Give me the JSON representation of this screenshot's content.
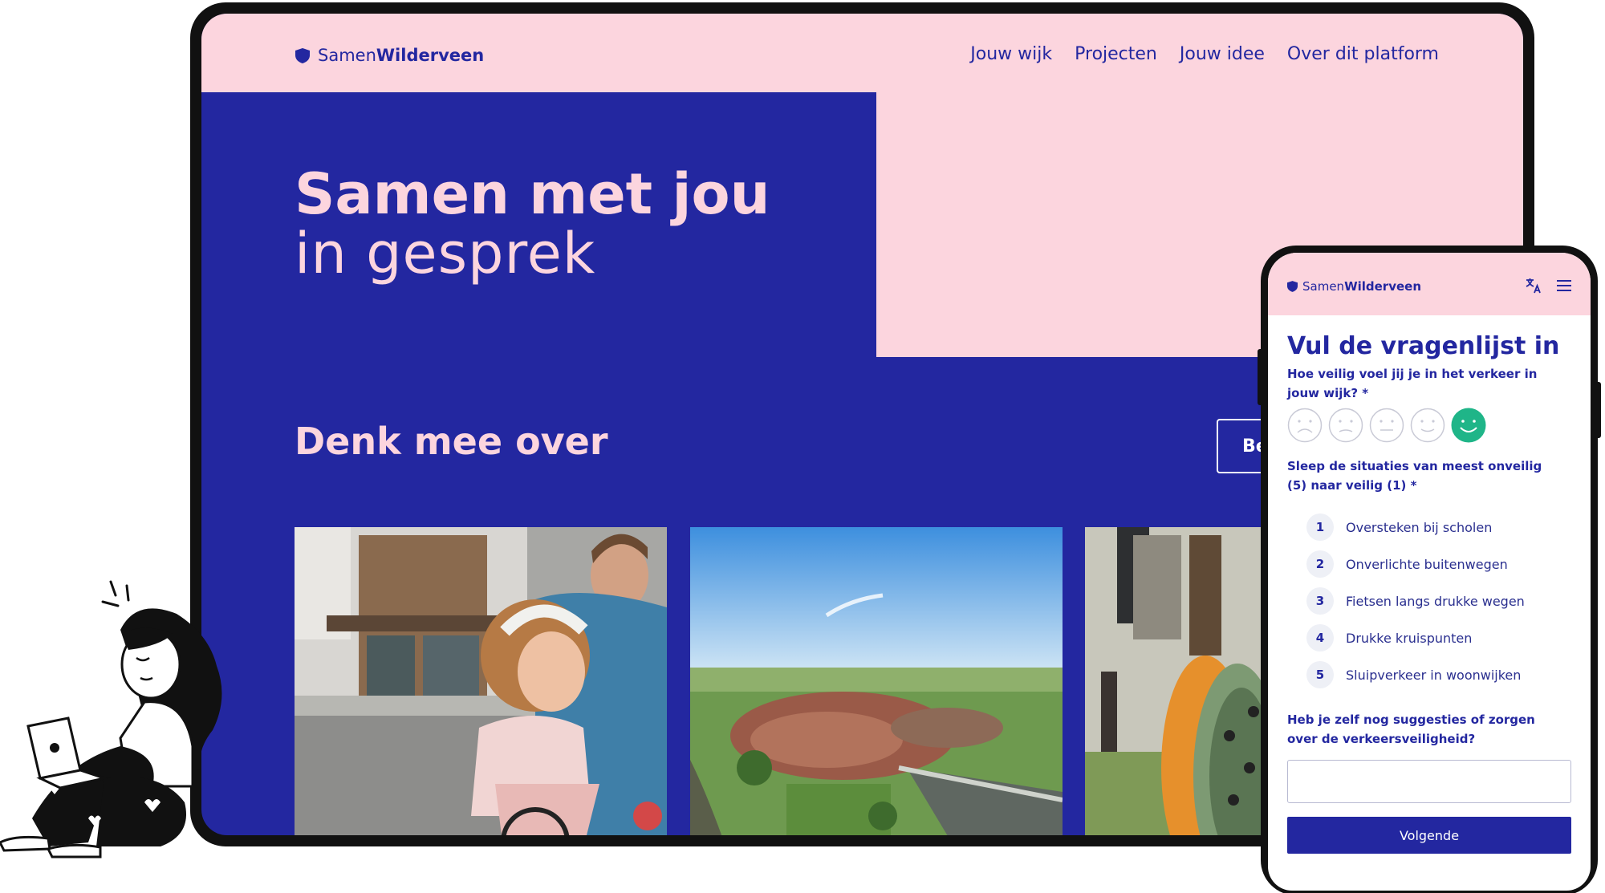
{
  "brand": {
    "light": "Samen",
    "bold": "Wilderveen"
  },
  "desktop": {
    "nav": [
      {
        "label": "Jouw wijk"
      },
      {
        "label": "Projecten"
      },
      {
        "label": "Jouw idee"
      },
      {
        "label": "Over dit platform"
      }
    ],
    "hero": {
      "line1": "Samen met jou",
      "line2": "in gesprek"
    },
    "section_title": "Denk mee over",
    "button_label": "Be"
  },
  "phone": {
    "title": "Vul de vragenlijst in",
    "question1": "Hoe veilig voel jij je in het verkeer in jouw wijk? *",
    "question2": "Sleep de situaties van meest onveilig (5) naar veilig (1) *",
    "ranking": [
      {
        "num": "1",
        "label": "Oversteken bij scholen"
      },
      {
        "num": "2",
        "label": "Onverlichte buitenwegen"
      },
      {
        "num": "3",
        "label": "Fietsen langs drukke wegen"
      },
      {
        "num": "4",
        "label": "Drukke kruispunten"
      },
      {
        "num": "5",
        "label": "Sluipverkeer in woonwijken"
      }
    ],
    "question3": "Heb je zelf nog suggesties of zorgen over de verkeersveiligheid?",
    "next_label": "Volgende",
    "selected_rating": 5
  },
  "colors": {
    "brand_blue": "#2327a0",
    "brand_pink": "#fcd5de",
    "selected_green": "#1fb588"
  }
}
